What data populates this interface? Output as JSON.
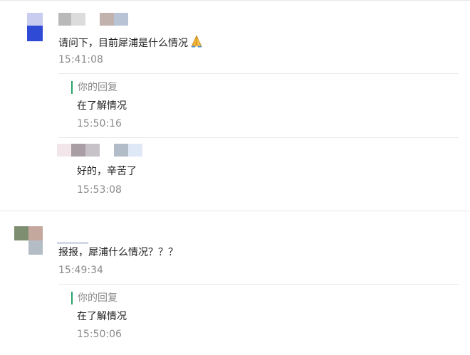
{
  "comments": [
    {
      "message": "请问下，目前犀浦是什么情况",
      "emoji": "pray-emoji",
      "time": "15:41:08",
      "replies": [
        {
          "label": "你的回复",
          "text": "在了解情况",
          "time": "15:50:16"
        },
        {
          "text": "好的，辛苦了",
          "time": "15:53:08"
        }
      ]
    },
    {
      "message": "报报，犀浦什么情况？？？",
      "time": "15:49:34",
      "replies": [
        {
          "label": "你的回复",
          "text": "在了解情况",
          "time": "15:50:06"
        }
      ]
    }
  ],
  "colors": {
    "reply_bar": "#2aa36b",
    "time": "#8a8a8a",
    "divider": "#e8e8e8",
    "avatar_blue": "#2f4bd6"
  }
}
